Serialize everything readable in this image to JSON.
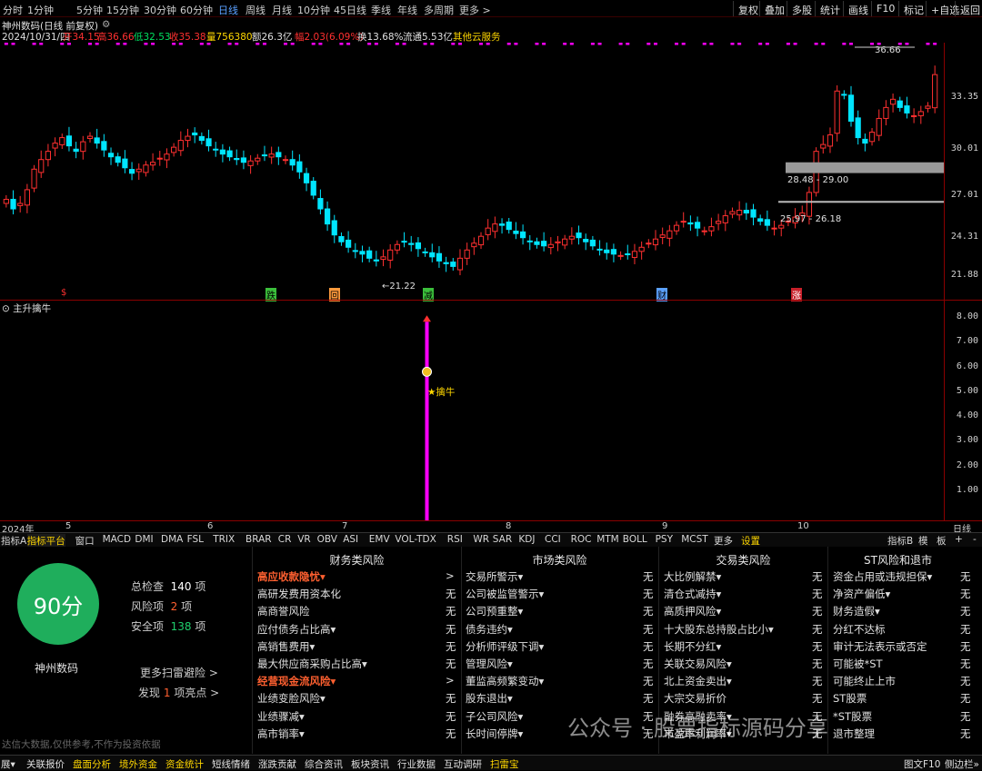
{
  "toolbar": {
    "periods": [
      "分时",
      "1分钟",
      "5分钟",
      "15分钟",
      "30分钟",
      "60分钟",
      "日线",
      "周线",
      "月线",
      "10分钟",
      "45日线",
      "季线",
      "年线",
      "多周期",
      "更多 >"
    ],
    "active": "日线",
    "right": [
      "复权",
      "叠加",
      "多股",
      "统计",
      "画线",
      "F10",
      "标记",
      "+自选",
      "返回"
    ]
  },
  "info": {
    "title": "神州数码(日线 前复权)",
    "date": "2024/10/31/四",
    "open_l": "开",
    "open": "34.15",
    "high_l": "高",
    "high": "36.66",
    "low_l": "低",
    "low": "32.53",
    "close_l": "收",
    "close": "35.38",
    "vol_l": "量",
    "vol": "756380",
    "amt_l": "额",
    "amt": "26.3亿",
    "chg_l": "幅",
    "chg": "2.03(6.09%)",
    "turn_l": "换",
    "turn": "13.68%",
    "float_l": "流通",
    "float": "5.53亿",
    "sector": "其他云服务"
  },
  "kline": {
    "ylabels": [
      "33.35",
      "30.01",
      "27.01",
      "24.31",
      "21.88"
    ],
    "max_label": "36.66",
    "min_label": "←21.22",
    "zone1": "28.48 - 29.00",
    "zone2": "25.97 - 26.18",
    "markers": [
      "$",
      "跌",
      "回",
      "减",
      "财",
      "涨"
    ]
  },
  "indicator": {
    "name": "主升擒牛",
    "ylabels": [
      "8.00",
      "7.00",
      "6.00",
      "5.00",
      "4.00",
      "3.00",
      "2.00",
      "1.00"
    ],
    "signal_label": "擒牛",
    "value": 7.8
  },
  "dates": [
    "2024年",
    "5",
    "6",
    "7",
    "8",
    "9",
    "10",
    "日线"
  ],
  "tabs": [
    "指标A",
    "指标平台",
    "窗口",
    "MACD",
    "DMI",
    "DMA",
    "FSL",
    "TRIX",
    "BRAR",
    "CR",
    "VR",
    "OBV",
    "ASI",
    "EMV",
    "VOL-TDX",
    "RSI",
    "WR",
    "SAR",
    "KDJ",
    "CCI",
    "ROC",
    "MTM",
    "BOLL",
    "PSY",
    "MCST",
    "更多",
    "设置"
  ],
  "tabs_right": [
    "指标B",
    "模",
    "板",
    "+",
    "-"
  ],
  "score": {
    "value": "90分",
    "stock": "神州数码",
    "total_l": "总检查",
    "total": "140",
    "total_u": "项",
    "risk_l": "风险项",
    "risk": "2",
    "risk_u": "项",
    "safe_l": "安全项",
    "safe": "138",
    "safe_u": "项",
    "more": "更多扫雷避险 >",
    "found_l": "发现",
    "found": "1",
    "found_r": "项亮点 >",
    "disclaimer": "达信大数据,仅供参考,不作为投资依据"
  },
  "risk_cols": [
    {
      "title": "财务类风险",
      "items": [
        [
          "高应收款隐忧▾",
          ">"
        ],
        [
          "高研发费用资本化",
          "无"
        ],
        [
          "高商誉风险",
          "无"
        ],
        [
          "应付债务占比高▾",
          "无"
        ],
        [
          "高销售费用▾",
          "无"
        ],
        [
          "最大供应商采购占比高▾",
          "无"
        ],
        [
          "经营现金流风险▾",
          ">"
        ],
        [
          "业绩变脸风险▾",
          "无"
        ],
        [
          "业绩骤减▾",
          "无"
        ],
        [
          "高市销率▾",
          "无"
        ]
      ]
    },
    {
      "title": "市场类风险",
      "items": [
        [
          "交易所警示▾",
          "无"
        ],
        [
          "公司被监管警示▾",
          "无"
        ],
        [
          "公司预重整▾",
          "无"
        ],
        [
          "债务违约▾",
          "无"
        ],
        [
          "分析师评级下调▾",
          "无"
        ],
        [
          "管理风险▾",
          "无"
        ],
        [
          "董监高频繁变动▾",
          "无"
        ],
        [
          "股东退出▾",
          "无"
        ],
        [
          "子公司风险▾",
          "无"
        ],
        [
          "长时间停牌▾",
          "无"
        ]
      ]
    },
    {
      "title": "交易类风险",
      "items": [
        [
          "大比例解禁▾",
          "无"
        ],
        [
          "清仓式减持▾",
          "无"
        ],
        [
          "高质押风险▾",
          "无"
        ],
        [
          "十大股东总持股占比小▾",
          "无"
        ],
        [
          "长期不分红▾",
          "无"
        ],
        [
          "关联交易风险▾",
          "无"
        ],
        [
          "北上资金卖出▾",
          "无"
        ],
        [
          "大宗交易折价",
          "无"
        ],
        [
          "融券高融卖率▾",
          "无"
        ],
        [
          "市盈率利润率▾",
          "无"
        ]
      ]
    },
    {
      "title": "ST风险和退市",
      "items": [
        [
          "资金占用或违规担保▾",
          "无"
        ],
        [
          "净资产偏低▾",
          "无"
        ],
        [
          "财务造假▾",
          "无"
        ],
        [
          "分红不达标",
          "无"
        ],
        [
          "审计无法表示或否定",
          "无"
        ],
        [
          "可能被*ST",
          "无"
        ],
        [
          "可能终止上市",
          "无"
        ],
        [
          "ST股票",
          "无"
        ],
        [
          "*ST股票",
          "无"
        ],
        [
          "退市整理",
          "无"
        ]
      ]
    }
  ],
  "watermark": "公众号 · 股票指标源码分享",
  "bottom": [
    "展▾",
    "关联报价",
    "盘面分析",
    "境外资金",
    "资金统计",
    "短线情绪",
    "涨跌贡献",
    "综合资讯",
    "板块资讯",
    "行业数据",
    "互动调研",
    "扫雷宝"
  ],
  "bottom_right": [
    "图文F10",
    "侧边栏»"
  ],
  "colors": {
    "up": "#ff3030",
    "down": "#00e5ff",
    "signal": "#ff00ff",
    "score": "#1fae5c"
  }
}
